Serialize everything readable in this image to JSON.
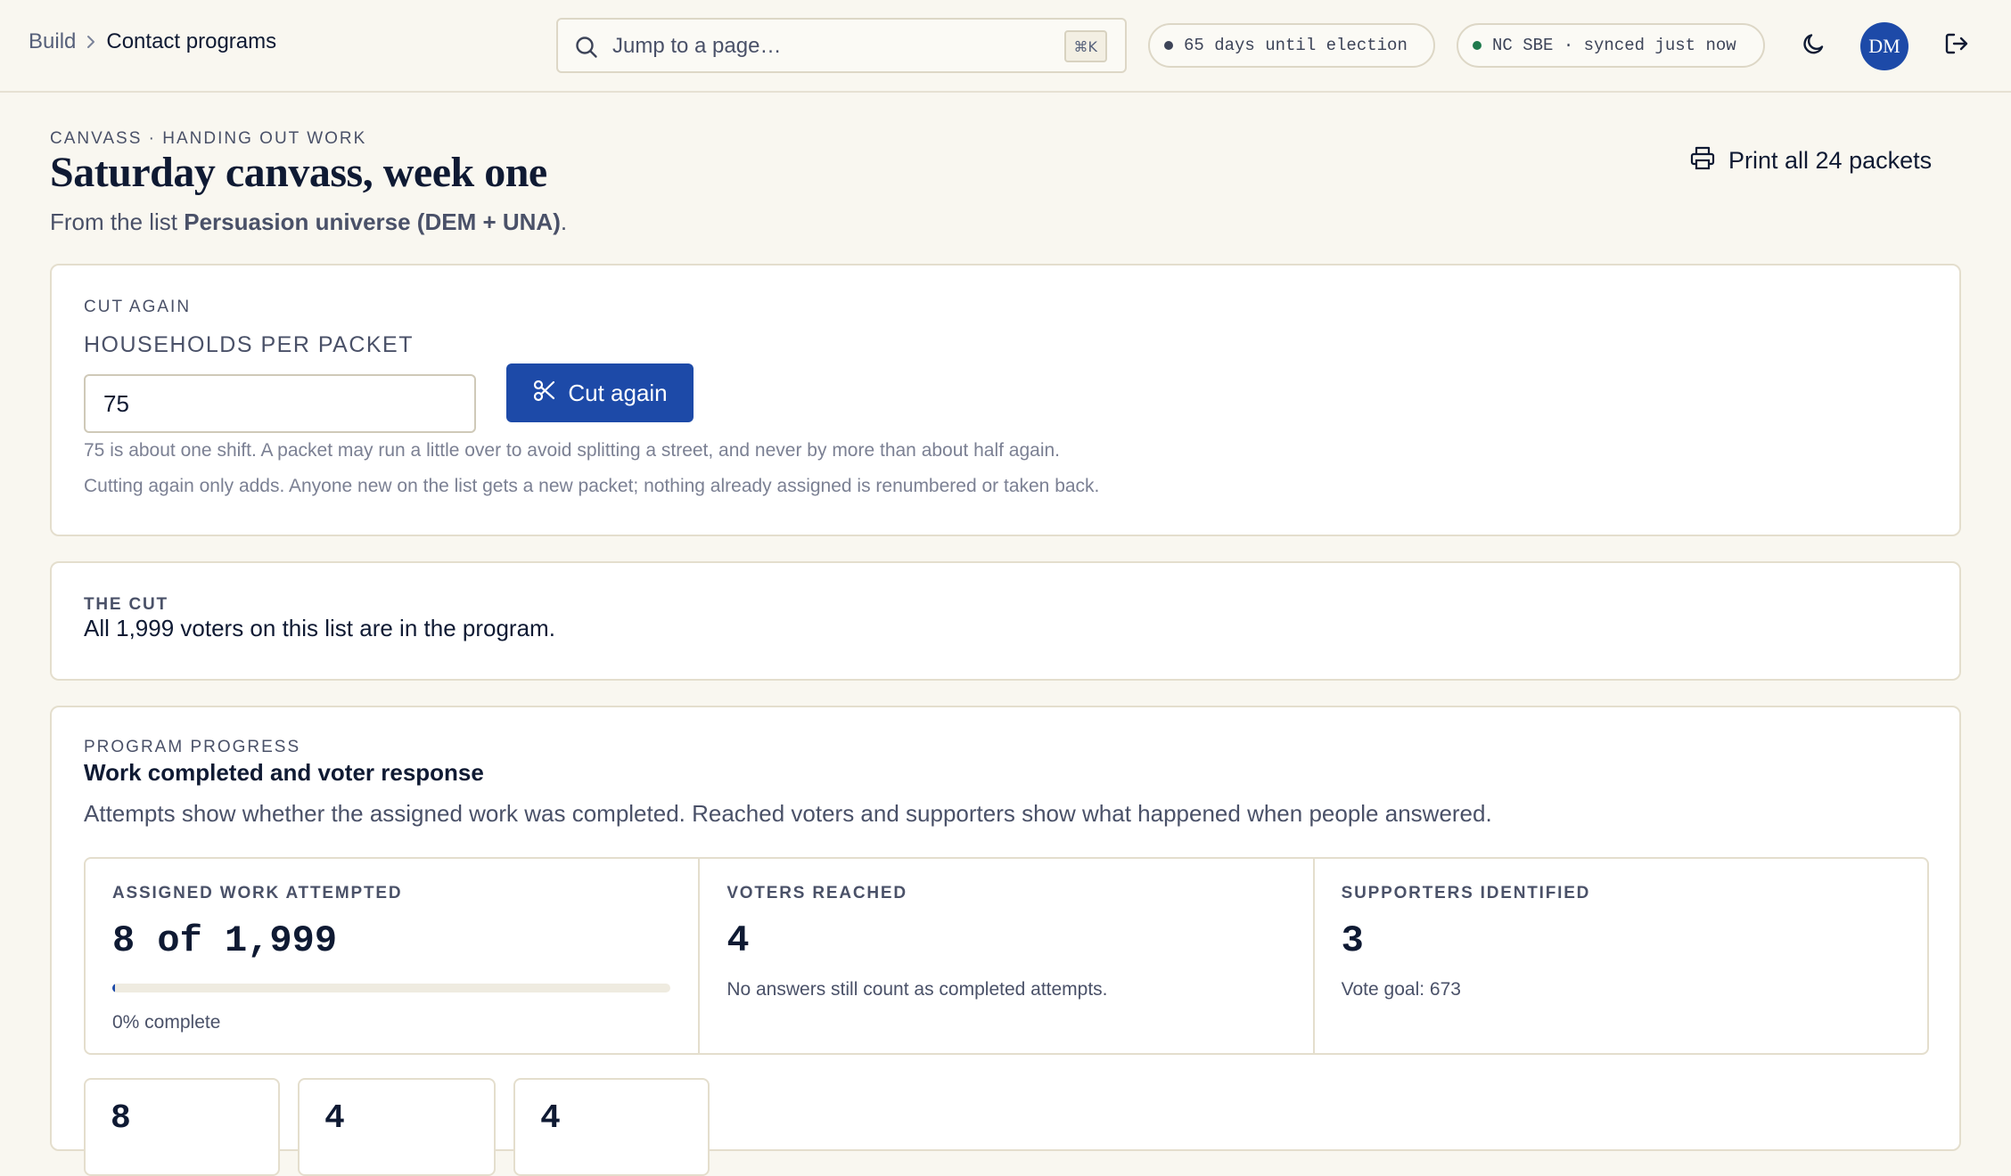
{
  "breadcrumb": {
    "parent": "Build",
    "current": "Contact programs"
  },
  "search": {
    "placeholder": "Jump to a page…",
    "shortcut": "⌘K"
  },
  "status": {
    "election_pill": "65 days until election",
    "election_dot_color": "#3d4458",
    "sync_pill": "NC SBE · synced just now",
    "sync_dot_color": "#1f7a4d"
  },
  "user": {
    "initials": "DM"
  },
  "page": {
    "eyebrow": "CANVASS · HANDING OUT WORK",
    "title": "Saturday canvass, week one",
    "subtitle_prefix": "From the list ",
    "subtitle_list": "Persuasion universe (DEM + UNA)",
    "subtitle_suffix": ".",
    "print_label": "Print all 24 packets"
  },
  "cut_again": {
    "eyebrow": "CUT AGAIN",
    "field_label": "HOUSEHOLDS PER PACKET",
    "field_value": "75",
    "button_label": "Cut again",
    "note1": "75 is about one shift. A packet may run a little over to avoid splitting a street, and never by more than about half again.",
    "note2": "Cutting again only adds. Anyone new on the list gets a new packet; nothing already assigned is renumbered or taken back."
  },
  "the_cut": {
    "eyebrow": "THE CUT",
    "text": "All 1,999 voters on this list are in the program."
  },
  "progress": {
    "eyebrow": "PROGRAM PROGRESS",
    "title": "Work completed and voter response",
    "description": "Attempts show whether the assigned work was completed. Reached voters and supporters show what happened when people answered.",
    "stats": [
      {
        "label": "ASSIGNED WORK ATTEMPTED",
        "value": "8 of 1,999",
        "progress_fraction": 0.004,
        "note": "0% complete"
      },
      {
        "label": "VOTERS REACHED",
        "value": "4",
        "note": "No answers still count as completed attempts."
      },
      {
        "label": "SUPPORTERS IDENTIFIED",
        "value": "3",
        "note": "Vote goal: 673"
      }
    ],
    "mini_values": [
      "8",
      "4",
      "4"
    ]
  },
  "colors": {
    "accent": "#1d4aa8",
    "background": "#f9f7f0",
    "border": "#e4decd"
  },
  "icons": {
    "search": "search-icon",
    "theme": "moon-icon",
    "logout": "logout-icon",
    "print": "printer-icon",
    "cut": "scissors-icon"
  }
}
